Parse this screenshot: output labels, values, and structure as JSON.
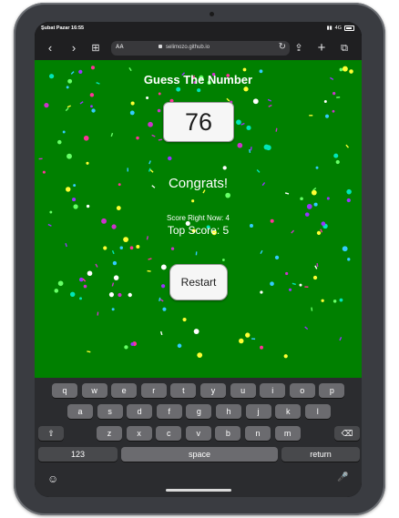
{
  "status": {
    "time": "Şubat Pazar 16:55",
    "network": "4G"
  },
  "browser": {
    "text_size_label": "AA",
    "url": "selimozo.github.io",
    "icons": [
      "back-icon",
      "forward-icon",
      "bookmarks-icon",
      "reload-icon",
      "share-icon",
      "new-tab-icon",
      "tabs-icon"
    ]
  },
  "game": {
    "title": "Guess The Number",
    "number": "76",
    "message": "Congrats!",
    "score_now": "Score Right Now: 4",
    "top_score": "Top Score: 5",
    "restart_label": "Restart",
    "background_color": "#008000"
  },
  "keyboard": {
    "row1": [
      "q",
      "w",
      "e",
      "r",
      "t",
      "y",
      "u",
      "i",
      "o",
      "p"
    ],
    "row2": [
      "a",
      "s",
      "d",
      "f",
      "g",
      "h",
      "j",
      "k",
      "l"
    ],
    "row3": [
      "z",
      "x",
      "c",
      "v",
      "b",
      "n",
      "m"
    ],
    "shift": "⇧",
    "delete": "⌫",
    "numbers": "123",
    "space": "space",
    "return": "return",
    "emoji": "☺",
    "mic": "🎤"
  }
}
